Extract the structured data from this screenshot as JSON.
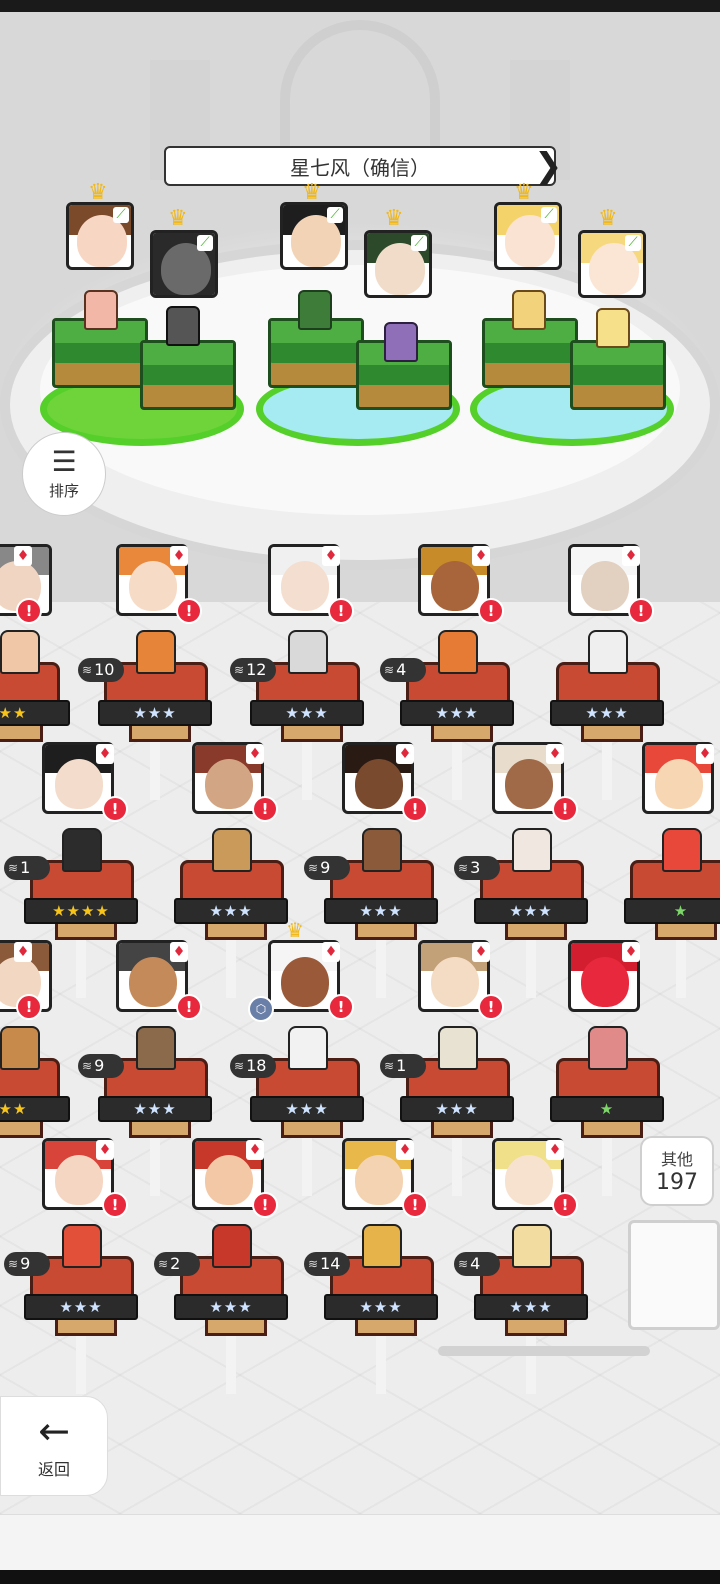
{
  "header": {
    "title": "星七风（确信）",
    "prev_icon": "chevron-left-icon",
    "next_icon": "chevron-right-icon"
  },
  "sort": {
    "label": "排序",
    "icon": "sort-down-icon"
  },
  "back": {
    "label": "返回",
    "icon": "arrow-left-icon"
  },
  "others": {
    "label": "其他",
    "count": "197"
  },
  "colors": {
    "accent_green": "#55d02a",
    "alert_red": "#e8283c",
    "pedestal": "#c84a33",
    "crown": "#f0b818"
  },
  "roster": [
    {
      "count": "10",
      "stars": "★★★"
    },
    {
      "count": "12",
      "stars": "★★★"
    },
    {
      "count": "4",
      "stars": "★★★"
    },
    {
      "count": "",
      "stars": "★★★"
    },
    {
      "count": "1",
      "stars": "★★★★"
    },
    {
      "count": "",
      "stars": "★★★"
    },
    {
      "count": "9",
      "stars": "★★★"
    },
    {
      "count": "3",
      "stars": "★★★"
    },
    {
      "count": "",
      "stars": "★"
    },
    {
      "count": "9",
      "stars": "★★★"
    },
    {
      "count": "18",
      "stars": "★★★"
    },
    {
      "count": "1",
      "stars": "★★★"
    },
    {
      "count": "",
      "stars": "★"
    },
    {
      "count": "9",
      "stars": "★★★"
    },
    {
      "count": "2",
      "stars": "★★★"
    },
    {
      "count": "14",
      "stars": "★★★"
    },
    {
      "count": "4",
      "stars": "★★★"
    }
  ],
  "edge_stars": [
    "★★",
    "★★"
  ]
}
